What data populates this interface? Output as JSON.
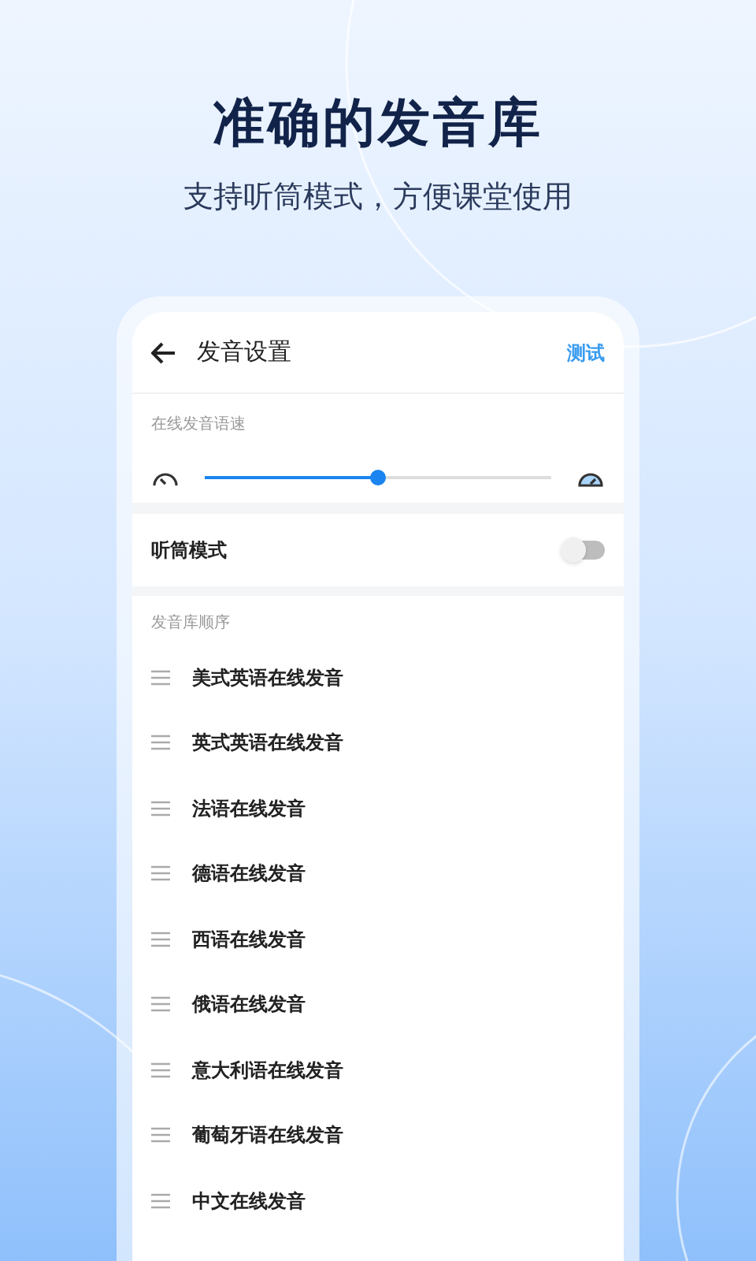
{
  "headline": "准确的发音库",
  "subtitle": "支持听筒模式，方便课堂使用",
  "screen": {
    "title": "发音设置",
    "action": "测试",
    "speed": {
      "label": "在线发音语速",
      "level": 0.5
    },
    "earpiece": {
      "label": "听筒模式",
      "on": false
    },
    "library": {
      "label": "发音库顺序",
      "items": [
        {
          "name": "美式英语在线发音"
        },
        {
          "name": "英式英语在线发音"
        },
        {
          "name": "法语在线发音"
        },
        {
          "name": "德语在线发音"
        },
        {
          "name": "西语在线发音"
        },
        {
          "name": "俄语在线发音"
        },
        {
          "name": "意大利语在线发音"
        },
        {
          "name": "葡萄牙语在线发音"
        },
        {
          "name": "中文在线发音"
        }
      ]
    }
  }
}
